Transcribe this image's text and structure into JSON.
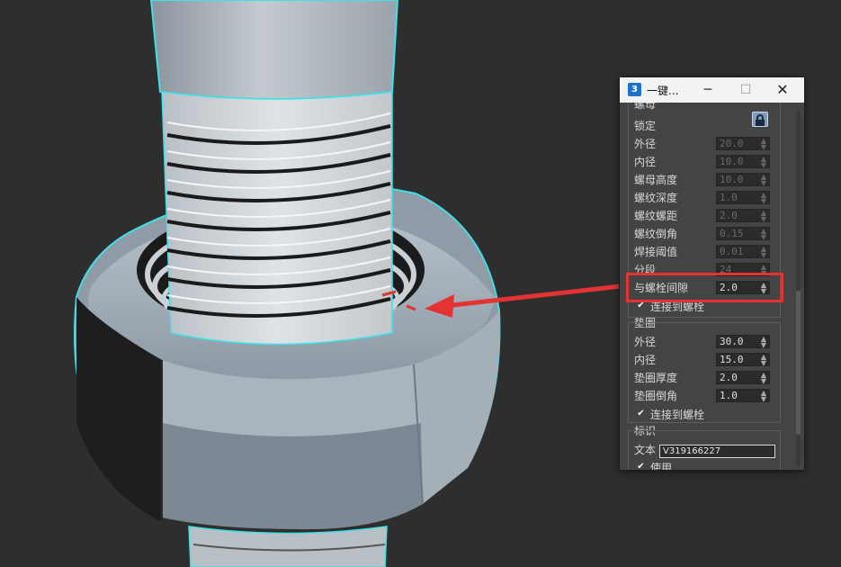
{
  "window": {
    "title": "一键...",
    "app_icon": "3",
    "minimize_glyph": "─",
    "maximize_glyph": "☐",
    "close_glyph": "✕"
  },
  "nut": {
    "header": "螺母",
    "lock_label": "锁定",
    "rows": [
      {
        "label": "外径",
        "value": "20.0",
        "enabled": false
      },
      {
        "label": "内径",
        "value": "10.0",
        "enabled": false
      },
      {
        "label": "螺母高度",
        "value": "10.0",
        "enabled": false
      },
      {
        "label": "螺纹深度",
        "value": "1.0",
        "enabled": false
      },
      {
        "label": "螺纹螺距",
        "value": "2.0",
        "enabled": false
      },
      {
        "label": "螺纹倒角",
        "value": "0.15",
        "enabled": false
      },
      {
        "label": "焊接阈值",
        "value": "0.01",
        "enabled": false
      },
      {
        "label": "分段",
        "value": "24",
        "enabled": false
      },
      {
        "label": "与螺栓间隙",
        "value": "2.0",
        "enabled": true
      }
    ],
    "connect_label": "连接到螺栓"
  },
  "washer": {
    "header": "垫圈",
    "rows": [
      {
        "label": "外径",
        "value": "30.0"
      },
      {
        "label": "内径",
        "value": "15.0"
      },
      {
        "label": "垫圈厚度",
        "value": "2.0"
      },
      {
        "label": "垫圈倒角",
        "value": "1.0"
      }
    ],
    "connect_label": "连接到螺栓"
  },
  "tag": {
    "header": "标识",
    "text_label": "文本",
    "text_value": "V319166227",
    "use_label": "使用"
  },
  "icons": {
    "lock": "lock-icon",
    "spinner": "spinner-arrows-icon",
    "check": "checkmark-icon",
    "annotation_arrow": "red-arrow-icon"
  },
  "colors": {
    "highlight": "#e53232",
    "selection_outline": "#3fe0e8",
    "dialog_bg": "#444444",
    "viewport_bg": "#2e2e2e"
  }
}
